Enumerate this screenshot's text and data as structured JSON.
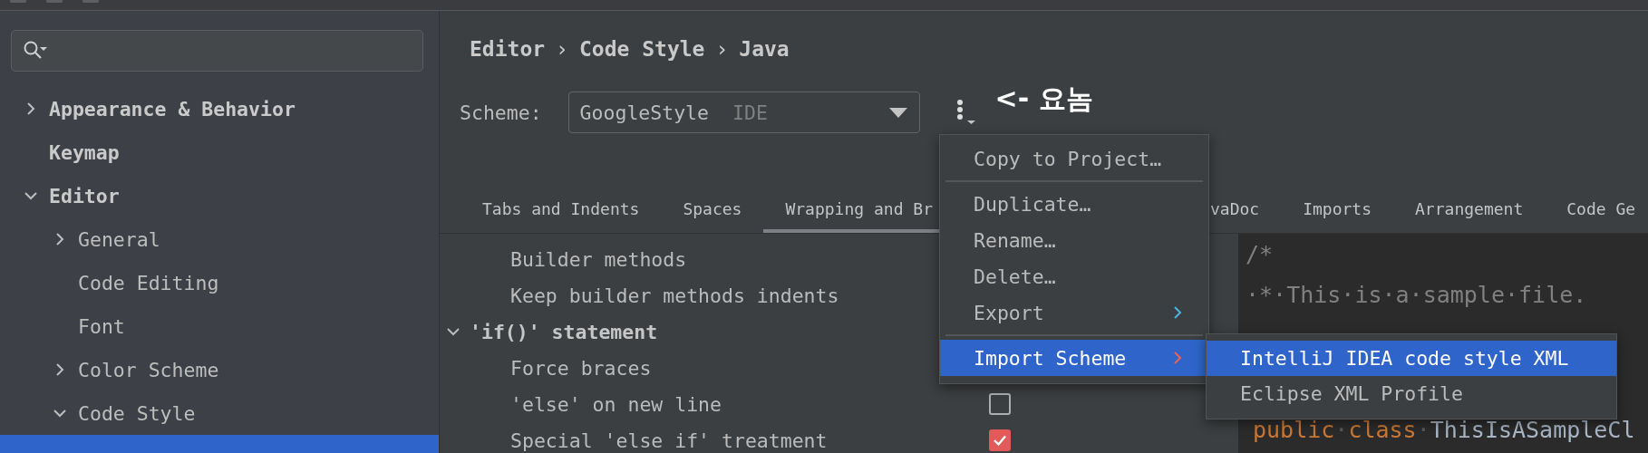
{
  "sidebar": {
    "items": [
      {
        "label": "Appearance & Behavior",
        "expanded": false,
        "selected": false
      },
      {
        "label": "Keymap",
        "selected": false
      },
      {
        "label": "Editor",
        "expanded": true,
        "selected": false,
        "children": [
          {
            "label": "General",
            "expanded": false,
            "selected": false
          },
          {
            "label": "Code Editing",
            "selected": false
          },
          {
            "label": "Font",
            "selected": false
          },
          {
            "label": "Color Scheme",
            "expanded": false,
            "selected": false
          },
          {
            "label": "Code Style",
            "expanded": true,
            "selected": false,
            "children": [
              {
                "selected": true
              }
            ]
          }
        ]
      }
    ]
  },
  "breadcrumb": [
    {
      "kind": "crumb",
      "text": "Editor"
    },
    {
      "kind": "separator",
      "text": "›"
    },
    {
      "kind": "crumb",
      "text": "Code Style"
    },
    {
      "kind": "separator",
      "text": "›"
    },
    {
      "kind": "crumb",
      "text": "Java"
    }
  ],
  "scheme": {
    "label": "Scheme:",
    "value": "GoogleStyle",
    "tag": "IDE"
  },
  "annotation": "<- 요놈",
  "tabs": [
    {
      "label": "Tabs and Indents",
      "selected": false
    },
    {
      "label": "Spaces",
      "selected": false
    },
    {
      "label": "Wrapping and Br",
      "selected": true
    },
    {
      "label": "vaDoc",
      "selected": false
    },
    {
      "label": "Imports",
      "selected": false
    },
    {
      "label": "Arrangement",
      "selected": false
    },
    {
      "label": "Code Ge",
      "selected": false
    }
  ],
  "options": [
    {
      "kind": "option",
      "label": "Builder methods"
    },
    {
      "kind": "option",
      "label": "Keep builder methods indents"
    },
    {
      "kind": "group",
      "label": "'if()' statement",
      "expanded": true
    },
    {
      "kind": "option",
      "label": "Force braces"
    },
    {
      "kind": "checkbox",
      "label": "'else' on new line",
      "checked": false
    },
    {
      "kind": "checkbox",
      "label": "Special 'else if' treatment",
      "checked": true
    }
  ],
  "code_preview": {
    "lines": [
      {
        "kind": "comment",
        "text": "/*"
      },
      {
        "kind": "comment",
        "text": "·*·This·is·a·sample·file."
      },
      {
        "kind": "code",
        "tokens": [
          {
            "kind": "keyword",
            "text": "public"
          },
          {
            "kind": "space",
            "text": "·"
          },
          {
            "kind": "keyword",
            "text": "class"
          },
          {
            "kind": "space",
            "text": "·"
          },
          {
            "kind": "plain",
            "text": "ThisIsASampleCl"
          }
        ]
      }
    ]
  },
  "menu": {
    "items": [
      {
        "kind": "item",
        "label": "Copy to Project…",
        "submenu": false,
        "selected": false
      },
      {
        "kind": "separator"
      },
      {
        "kind": "item",
        "label": "Duplicate…",
        "submenu": false,
        "selected": false
      },
      {
        "kind": "item",
        "label": "Rename…",
        "submenu": false,
        "selected": false
      },
      {
        "kind": "item",
        "label": "Delete…",
        "submenu": false,
        "selected": false
      },
      {
        "kind": "item",
        "label": "Export",
        "submenu": true,
        "selected": false
      },
      {
        "kind": "separator"
      },
      {
        "kind": "item",
        "label": "Import Scheme",
        "submenu": true,
        "selected": true
      }
    ]
  },
  "submenu": {
    "items": [
      {
        "label": "IntelliJ IDEA code style XML",
        "selected": true
      },
      {
        "label": "Eclipse XML Profile",
        "selected": false
      }
    ]
  }
}
